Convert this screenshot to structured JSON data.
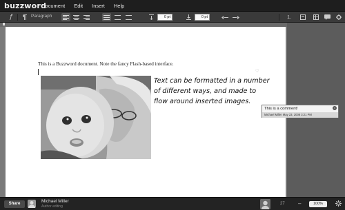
{
  "app": {
    "logo": "buzzword"
  },
  "menu": [
    "Document",
    "Edit",
    "Insert",
    "Help"
  ],
  "toolbar": {
    "paragraph_style": "Paragraph",
    "space_before": "0 pt",
    "space_after": "0 pt",
    "list_number": "1."
  },
  "document": {
    "intro": "This is a Buzzword document. Note the fancy Flash-based interface.",
    "flow_text": "Text can be formatted in a number of different ways, and made to flow around inserted images."
  },
  "comment": {
    "text": "This is a comment!",
    "meta": "Michael Miller  May 23, 2008  3:21 PM"
  },
  "statusbar": {
    "share_label": "Share",
    "user_name": "Michael Miller",
    "user_status": "Author editing",
    "page_count": "27",
    "zoom": "100%"
  }
}
